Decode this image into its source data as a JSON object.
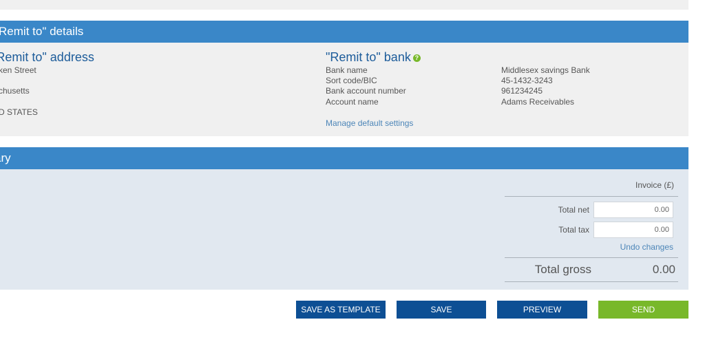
{
  "remit_details": {
    "title": "\"Remit to\" details"
  },
  "address": {
    "title": "\"Remit to\" address",
    "lines": [
      "ken Street",
      "",
      "chusetts",
      "",
      "D STATES"
    ]
  },
  "bank": {
    "title": "\"Remit to\" bank",
    "help_icon": "help-circle-icon",
    "rows": [
      {
        "label": "Bank name",
        "value": "Middlesex savings Bank"
      },
      {
        "label": "Sort code/BIC",
        "value": "45-1432-3243"
      },
      {
        "label": "Bank account number",
        "value": "961234245"
      },
      {
        "label": "Account name",
        "value": "Adams Receivables"
      }
    ],
    "manage_link": "Manage default settings"
  },
  "summary": {
    "title": "ary",
    "column": "Invoice (£)",
    "total_net_label": "Total net",
    "total_net": "0.00",
    "total_tax_label": "Total tax",
    "total_tax": "0.00",
    "undo": "Undo changes",
    "total_gross_label": "Total gross",
    "total_gross": "0.00"
  },
  "buttons": {
    "save_template": "SAVE AS TEMPLATE",
    "save": "SAVE",
    "preview": "PREVIEW",
    "send": "SEND"
  },
  "colors": {
    "header": "#3a87c8",
    "primary": "#0d4f94",
    "send": "#78b82a"
  }
}
